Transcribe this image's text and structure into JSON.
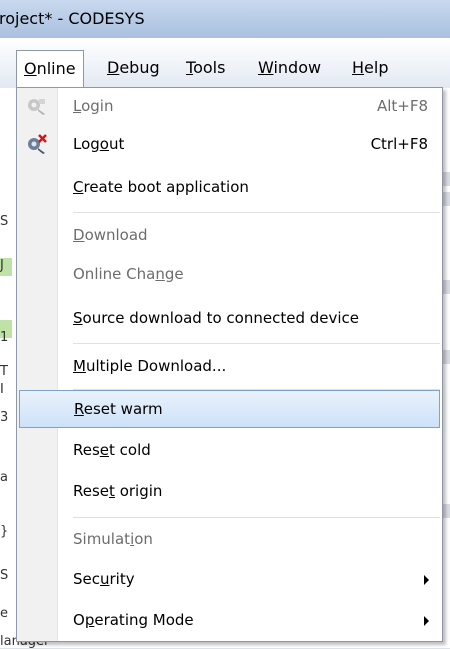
{
  "titlebar": {
    "title": "roject* - CODESYS"
  },
  "menubar": {
    "items": [
      {
        "label": "Online",
        "ul": 0
      },
      {
        "label": "Debug",
        "ul": 0
      },
      {
        "label": "Tools",
        "ul": 0
      },
      {
        "label": "Window",
        "ul": 0
      },
      {
        "label": "Help",
        "ul": 0
      }
    ]
  },
  "background": {
    "fragments": [
      "S",
      "J",
      "1",
      "T",
      "I",
      "3",
      "a",
      "}",
      "S",
      "e",
      "lanager"
    ]
  },
  "dropdown": {
    "items": [
      {
        "label": "Login",
        "shortcut": "Alt+F8",
        "ul": 0
      },
      {
        "label": "Logout",
        "shortcut": "Ctrl+F8",
        "ul": 3
      },
      {
        "label": "Create boot application",
        "shortcut": "",
        "ul": 0
      },
      {
        "label": "Download",
        "shortcut": "",
        "ul": 0
      },
      {
        "label": "Online Change",
        "shortcut": "",
        "ul": 10
      },
      {
        "label": "Source download to connected device",
        "shortcut": "",
        "ul": 0
      },
      {
        "label": "Multiple Download...",
        "shortcut": "",
        "ul": 0
      },
      {
        "label": "Reset warm",
        "shortcut": "",
        "ul": 0
      },
      {
        "label": "Reset cold",
        "shortcut": "",
        "ul": 3
      },
      {
        "label": "Reset origin",
        "shortcut": "",
        "ul": 4
      },
      {
        "label": "Simulation",
        "shortcut": "",
        "ul": 7
      },
      {
        "label": "Security",
        "shortcut": "",
        "ul": 3
      },
      {
        "label": "Operating Mode",
        "shortcut": "",
        "ul": 1
      }
    ]
  },
  "colors": {
    "highlight_border": "#7da2ce",
    "disabled_text": "#6d6d6d",
    "titlebar": "#b7cbe6"
  }
}
